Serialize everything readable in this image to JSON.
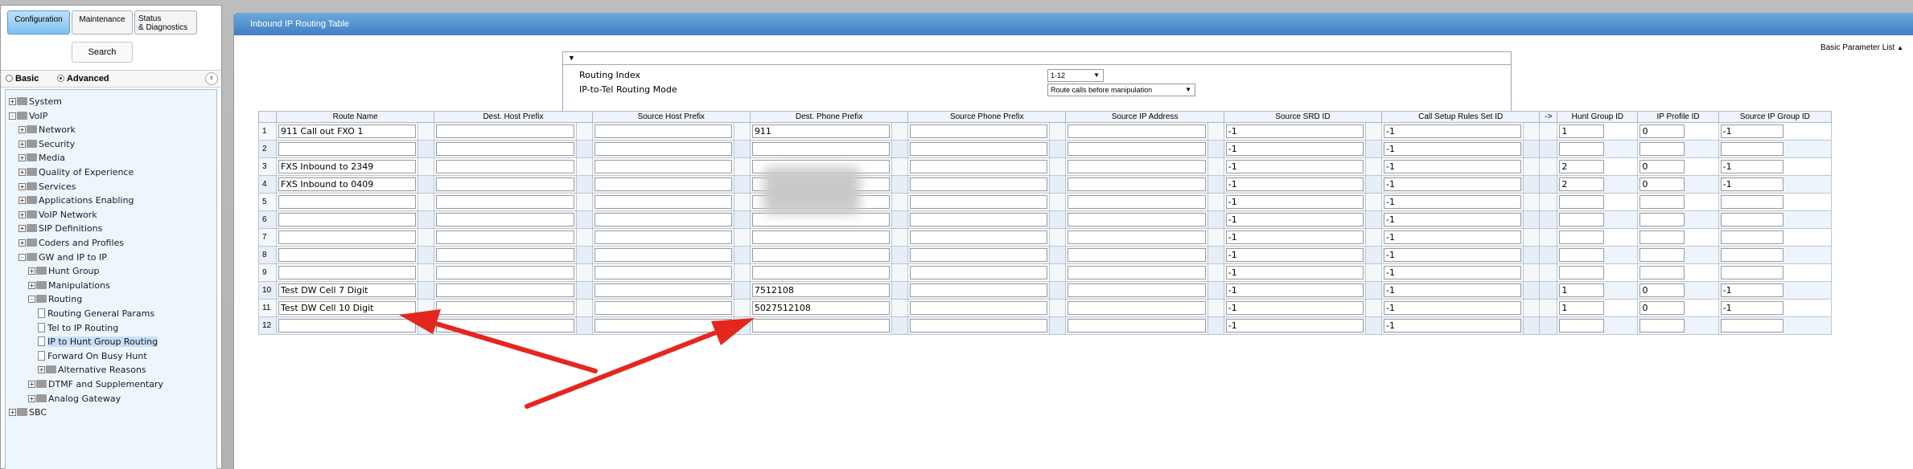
{
  "nav": {
    "tabs": [
      "Configuration",
      "Maintenance",
      "Status & Diagnostics"
    ],
    "tab_status_line1": "Status",
    "tab_status_line2": "& Diagnostics",
    "search_label": "Search",
    "mode_basic": "Basic",
    "mode_advanced": "Advanced",
    "selected_mode": "Advanced"
  },
  "tree": [
    {
      "label": "System",
      "level": 0,
      "kind": "folder",
      "exp": "+"
    },
    {
      "label": "VoIP",
      "level": 0,
      "kind": "folder",
      "exp": "-"
    },
    {
      "label": "Network",
      "level": 1,
      "kind": "folder",
      "exp": "+"
    },
    {
      "label": "Security",
      "level": 1,
      "kind": "folder",
      "exp": "+"
    },
    {
      "label": "Media",
      "level": 1,
      "kind": "folder",
      "exp": "+"
    },
    {
      "label": "Quality of Experience",
      "level": 1,
      "kind": "folder",
      "exp": "+"
    },
    {
      "label": "Services",
      "level": 1,
      "kind": "folder",
      "exp": "+"
    },
    {
      "label": "Applications Enabling",
      "level": 1,
      "kind": "folder",
      "exp": "+"
    },
    {
      "label": "VoIP Network",
      "level": 1,
      "kind": "folder",
      "exp": "+"
    },
    {
      "label": "SIP Definitions",
      "level": 1,
      "kind": "folder",
      "exp": "+"
    },
    {
      "label": "Coders and Profiles",
      "level": 1,
      "kind": "folder",
      "exp": "+"
    },
    {
      "label": "GW and IP to IP",
      "level": 1,
      "kind": "folder",
      "exp": "-"
    },
    {
      "label": "Hunt Group",
      "level": 2,
      "kind": "folder",
      "exp": "+"
    },
    {
      "label": "Manipulations",
      "level": 2,
      "kind": "folder",
      "exp": "+"
    },
    {
      "label": "Routing",
      "level": 2,
      "kind": "folder",
      "exp": "-"
    },
    {
      "label": "Routing General Params",
      "level": 3,
      "kind": "page",
      "exp": ""
    },
    {
      "label": "Tel to IP Routing",
      "level": 3,
      "kind": "page",
      "exp": ""
    },
    {
      "label": "IP to Hunt Group Routing",
      "level": 3,
      "kind": "page",
      "exp": "",
      "selected": true
    },
    {
      "label": "Forward On Busy Hunt",
      "level": 3,
      "kind": "page",
      "exp": ""
    },
    {
      "label": "Alternative Reasons",
      "level": 3,
      "kind": "folder",
      "exp": "+"
    },
    {
      "label": "DTMF and Supplementary",
      "level": 2,
      "kind": "folder",
      "exp": "+"
    },
    {
      "label": "Analog Gateway",
      "level": 2,
      "kind": "folder",
      "exp": "+"
    },
    {
      "label": "SBC",
      "level": 0,
      "kind": "folder",
      "exp": "+"
    }
  ],
  "page": {
    "title": "Inbound IP Routing Table",
    "basic_param_list": "Basic Parameter List",
    "routing_index_label": "Routing Index",
    "routing_index_value": "1-12",
    "routing_mode_label": "IP-to-Tel Routing Mode",
    "routing_mode_value": "Route calls before manipulation"
  },
  "table": {
    "columns": [
      "Route Name",
      "Dest. Host Prefix",
      "Source Host Prefix",
      "Dest. Phone Prefix",
      "Source Phone Prefix",
      "Source IP Address",
      "Source SRD ID",
      "Call Setup Rules Set ID",
      "->",
      "Hunt Group ID",
      "IP Profile ID",
      "Source IP Group ID"
    ],
    "rows": [
      {
        "n": "1",
        "route_name": "911 Call out FXO 1",
        "dest_host": "",
        "src_host": "",
        "dest_phone": "911",
        "src_phone": "",
        "src_ip": "",
        "srd": "-1",
        "rules": "-1",
        "hunt": "1",
        "profile": "0",
        "ipgroup": "-1"
      },
      {
        "n": "2",
        "route_name": "",
        "dest_host": "",
        "src_host": "",
        "dest_phone": "",
        "src_phone": "",
        "src_ip": "",
        "srd": "-1",
        "rules": "-1",
        "hunt": "",
        "profile": "",
        "ipgroup": ""
      },
      {
        "n": "3",
        "route_name": "FXS Inbound to 2349",
        "dest_host": "",
        "src_host": "",
        "dest_phone": "",
        "src_phone": "",
        "src_ip": "",
        "srd": "-1",
        "rules": "-1",
        "hunt": "2",
        "profile": "0",
        "ipgroup": "-1"
      },
      {
        "n": "4",
        "route_name": "FXS Inbound to 0409",
        "dest_host": "",
        "src_host": "",
        "dest_phone": "",
        "src_phone": "",
        "src_ip": "",
        "srd": "-1",
        "rules": "-1",
        "hunt": "2",
        "profile": "0",
        "ipgroup": "-1"
      },
      {
        "n": "5",
        "route_name": "",
        "dest_host": "",
        "src_host": "",
        "dest_phone": "",
        "src_phone": "",
        "src_ip": "",
        "srd": "-1",
        "rules": "-1",
        "hunt": "",
        "profile": "",
        "ipgroup": ""
      },
      {
        "n": "6",
        "route_name": "",
        "dest_host": "",
        "src_host": "",
        "dest_phone": "",
        "src_phone": "",
        "src_ip": "",
        "srd": "-1",
        "rules": "-1",
        "hunt": "",
        "profile": "",
        "ipgroup": ""
      },
      {
        "n": "7",
        "route_name": "",
        "dest_host": "",
        "src_host": "",
        "dest_phone": "",
        "src_phone": "",
        "src_ip": "",
        "srd": "-1",
        "rules": "-1",
        "hunt": "",
        "profile": "",
        "ipgroup": ""
      },
      {
        "n": "8",
        "route_name": "",
        "dest_host": "",
        "src_host": "",
        "dest_phone": "",
        "src_phone": "",
        "src_ip": "",
        "srd": "-1",
        "rules": "-1",
        "hunt": "",
        "profile": "",
        "ipgroup": ""
      },
      {
        "n": "9",
        "route_name": "",
        "dest_host": "",
        "src_host": "",
        "dest_phone": "",
        "src_phone": "",
        "src_ip": "",
        "srd": "-1",
        "rules": "-1",
        "hunt": "",
        "profile": "",
        "ipgroup": ""
      },
      {
        "n": "10",
        "route_name": "Test DW Cell 7 Digit",
        "dest_host": "",
        "src_host": "",
        "dest_phone": "7512108",
        "src_phone": "",
        "src_ip": "",
        "srd": "-1",
        "rules": "-1",
        "hunt": "1",
        "profile": "0",
        "ipgroup": "-1"
      },
      {
        "n": "11",
        "route_name": "Test DW Cell 10 Digit",
        "dest_host": "",
        "src_host": "",
        "dest_phone": "5027512108",
        "src_phone": "",
        "src_ip": "",
        "srd": "-1",
        "rules": "-1",
        "hunt": "1",
        "profile": "0",
        "ipgroup": "-1"
      },
      {
        "n": "12",
        "route_name": "",
        "dest_host": "",
        "src_host": "",
        "dest_phone": "",
        "src_phone": "",
        "src_ip": "",
        "srd": "-1",
        "rules": "-1",
        "hunt": "",
        "profile": "",
        "ipgroup": ""
      }
    ]
  },
  "colors": {
    "accent": "#4a8bc9",
    "annotation_arrow": "#e5261f"
  }
}
